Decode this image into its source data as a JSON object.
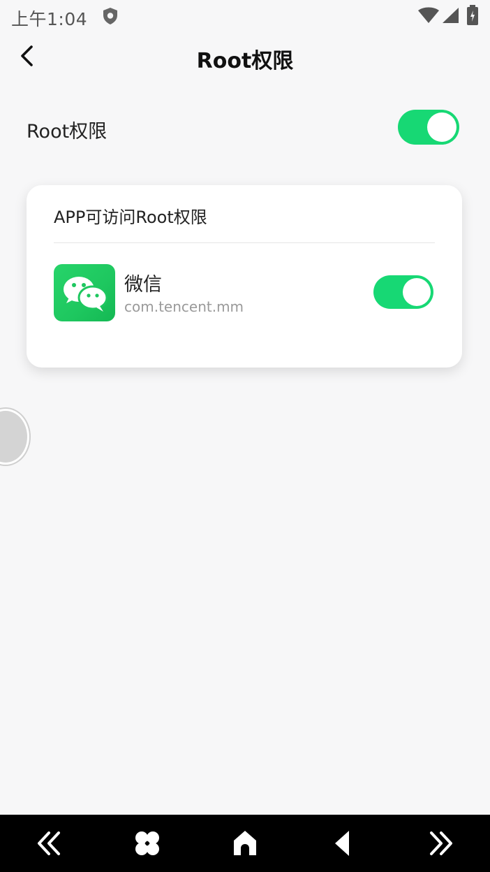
{
  "status_bar": {
    "time": "上午1:04",
    "icons": [
      "shield-icon",
      "wifi-icon",
      "signal-icon",
      "battery-icon"
    ]
  },
  "header": {
    "title": "Root权限",
    "back_icon": "chevron-left-icon"
  },
  "root_setting": {
    "label": "Root权限",
    "enabled": true
  },
  "app_card": {
    "title": "APP可访问Root权限",
    "apps": [
      {
        "name": "微信",
        "package": "com.tencent.mm",
        "icon": "wechat-icon",
        "enabled": true
      }
    ]
  },
  "nav_bar": {
    "buttons": [
      "double-chevron-left-icon",
      "apps-icon",
      "home-icon",
      "back-triangle-icon",
      "double-chevron-right-icon"
    ]
  },
  "colors": {
    "accent": "#17d874",
    "background": "#f7f7f8",
    "nav_background": "#000000",
    "wechat_green": "#1ec75f"
  }
}
